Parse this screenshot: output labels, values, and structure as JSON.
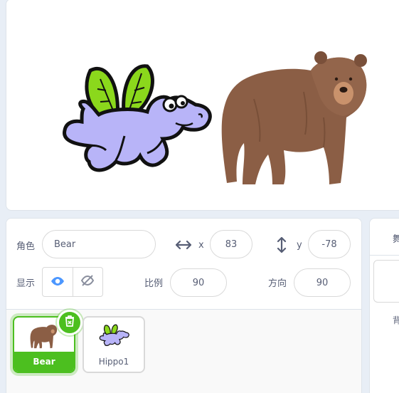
{
  "sprite_info": {
    "sprite_label": "角色",
    "sprite_name": "Bear",
    "x_label": "x",
    "x_value": "83",
    "y_label": "y",
    "y_value": "-78",
    "show_label": "显示",
    "size_label": "比例",
    "size_value": "90",
    "direction_label": "方向",
    "direction_value": "90"
  },
  "sprites": [
    {
      "name": "Bear",
      "selected": true
    },
    {
      "name": "Hippo1",
      "selected": false
    }
  ],
  "stage_pane": {
    "header_label": "舞",
    "backdrops_label": "背"
  },
  "icons": {
    "x_arrow": "horizontal-arrows-icon",
    "y_arrow": "vertical-arrows-icon",
    "show": "eye-icon",
    "hide": "eye-slash-icon",
    "delete": "trash-icon"
  },
  "colors": {
    "accent": "#4cbf1f",
    "show_active": "#4c97ff",
    "text": "#575e75"
  }
}
